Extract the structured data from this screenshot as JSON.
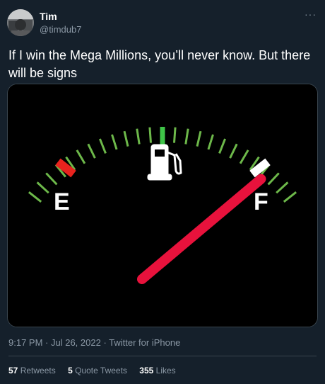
{
  "user": {
    "display_name": "Tim",
    "handle": "@timdub7"
  },
  "menu": {
    "more_label": "···"
  },
  "tweet": {
    "text": "If I win the Mega Millions, you’ll never know. But there will be signs"
  },
  "media": {
    "image_subject": "fuel-gauge",
    "labels": {
      "empty": "E",
      "full": "F"
    },
    "fuel_level": 1.0,
    "colors": {
      "needle": "#e8123c",
      "empty_mark": "#e8231e",
      "full_mark": "#ffffff",
      "tick": "#6db84a",
      "center_tick": "#3fc448"
    }
  },
  "meta": {
    "time": "9:17 PM",
    "separator": " · ",
    "date": "Jul 26, 2022",
    "source": "Twitter for iPhone"
  },
  "stats": {
    "retweets_count": "57",
    "retweets_label": "Retweets",
    "quotes_count": "5",
    "quotes_label": "Quote Tweets",
    "likes_count": "355",
    "likes_label": "Likes"
  },
  "theme": {
    "background": "#15202b",
    "secondary_text": "#8b98a5",
    "border": "#38444d"
  }
}
